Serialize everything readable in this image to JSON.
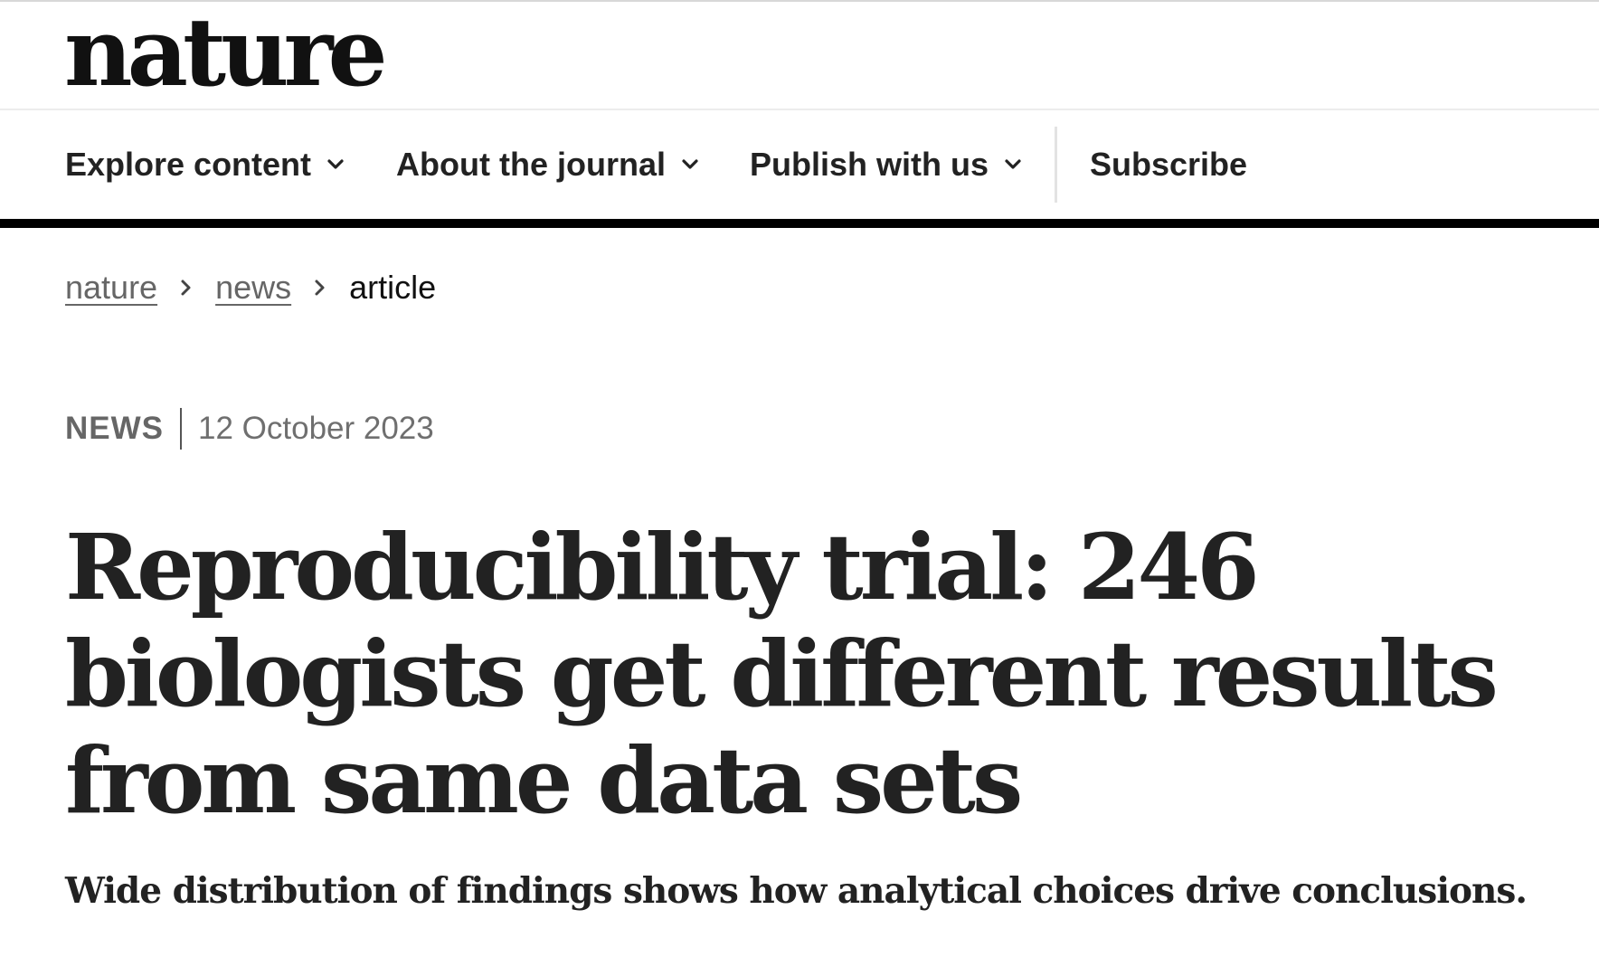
{
  "header": {
    "logo_text": "nature"
  },
  "nav": {
    "items": [
      {
        "label": "Explore content",
        "has_dropdown": true,
        "icon": "chevron-down-icon"
      },
      {
        "label": "About the journal",
        "has_dropdown": true,
        "icon": "chevron-down-icon"
      },
      {
        "label": "Publish with us",
        "has_dropdown": true,
        "icon": "chevron-down-icon"
      },
      {
        "label": "Subscribe",
        "has_dropdown": false
      }
    ]
  },
  "breadcrumb": {
    "items": [
      {
        "label": "nature",
        "link": true
      },
      {
        "label": "news",
        "link": true
      },
      {
        "label": "article",
        "link": false
      }
    ],
    "separator_icon": "chevron-right-icon"
  },
  "article": {
    "type": "NEWS",
    "date": "12 October 2023",
    "title": "Reproducibility trial: 246 biologists get different results from same data sets",
    "standfirst": "Wide distribution of findings shows how analytical choices drive conclusions."
  },
  "colors": {
    "nav_rule": "#000000",
    "text_primary": "#222222",
    "text_muted": "#666666"
  }
}
